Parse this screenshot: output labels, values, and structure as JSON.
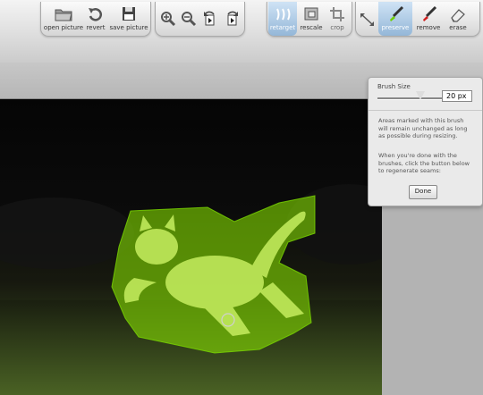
{
  "toolbar": {
    "file_tools": [
      {
        "label": "open picture",
        "icon": "folder-icon"
      },
      {
        "label": "revert",
        "icon": "revert-icon"
      },
      {
        "label": "save picture",
        "icon": "floppy-disk-icon"
      }
    ],
    "view_tools": [
      {
        "icon": "zoom-in-icon"
      },
      {
        "icon": "zoom-out-icon"
      },
      {
        "icon": "rotate-left-icon"
      },
      {
        "icon": "rotate-right-icon"
      }
    ],
    "edit_tools": [
      {
        "label": "retarget",
        "icon": "retarget-icon",
        "active": true
      },
      {
        "label": "rescale",
        "icon": "rescale-icon"
      },
      {
        "label": "crop",
        "icon": "crop-icon"
      }
    ],
    "brush_tools": [
      {
        "icon": "resize-arrows-icon"
      },
      {
        "label": "preserve",
        "icon": "preserve-brush-icon",
        "active": true
      },
      {
        "label": "remove",
        "icon": "remove-brush-icon"
      },
      {
        "label": "erase",
        "icon": "eraser-icon"
      }
    ]
  },
  "brush_panel": {
    "title": "Brush Size",
    "size_value": "20 px",
    "slider_fraction": 0.65,
    "description": "Areas marked with this brush will remain unchanged as long as possible during resizing.",
    "instructions": "When you're done with the brushes, click the button below to regenerate seams:",
    "done_label": "Done"
  },
  "colors": {
    "highlight": "#8ff000",
    "active_tool": "#94b7d8"
  }
}
